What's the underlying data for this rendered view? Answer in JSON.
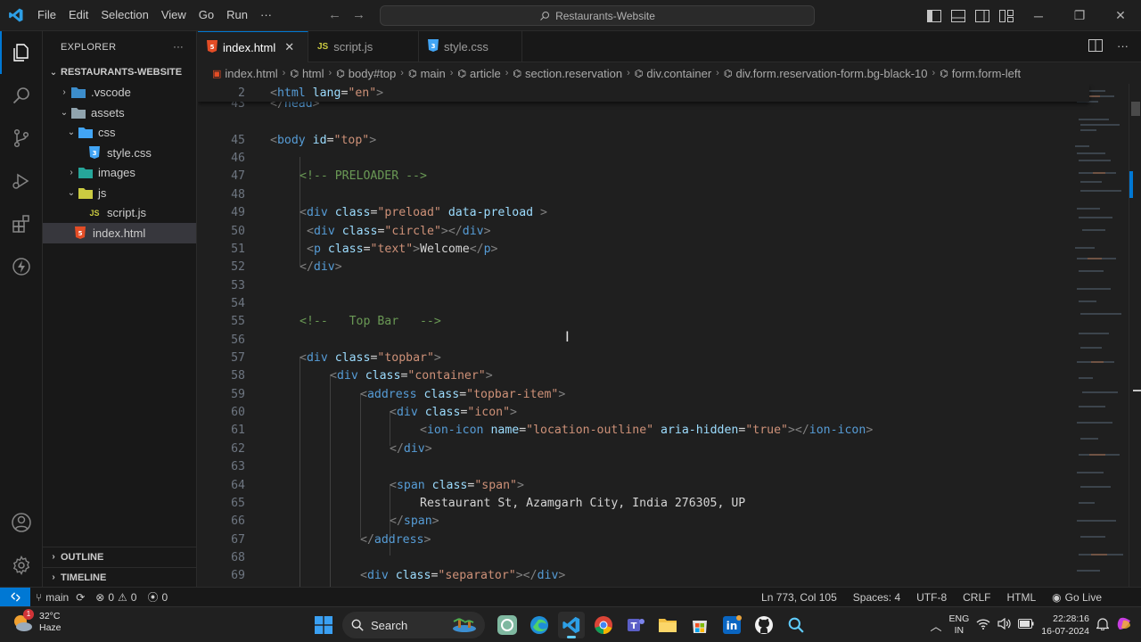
{
  "menu": [
    "File",
    "Edit",
    "Selection",
    "View",
    "Go",
    "Run"
  ],
  "menu_more": "···",
  "command_center": "Restaurants-Website",
  "explorer": {
    "title": "EXPLORER",
    "more": "···",
    "root": "RESTAURANTS-WEBSITE",
    "items": [
      ".vscode",
      "assets",
      "css",
      "style.css",
      "images",
      "js",
      "script.js",
      "index.html"
    ],
    "outline": "OUTLINE",
    "timeline": "TIMELINE"
  },
  "tabs": [
    {
      "label": "index.html",
      "icon": "html-file-icon"
    },
    {
      "label": "script.js",
      "icon": "js-file-icon"
    },
    {
      "label": "style.css",
      "icon": "css-file-icon"
    }
  ],
  "breadcrumb": [
    "index.html",
    "html",
    "body#top",
    "main",
    "article",
    "section.reservation",
    "div.container",
    "div.form.reservation-form.bg-black-10",
    "form.form-left"
  ],
  "sticky_line": {
    "number": "2"
  },
  "editor_lines": [
    {
      "n": "43"
    },
    {
      "n": "45"
    },
    {
      "n": "46"
    },
    {
      "n": "47"
    },
    {
      "n": "48"
    },
    {
      "n": "49"
    },
    {
      "n": "50"
    },
    {
      "n": "51"
    },
    {
      "n": "52"
    },
    {
      "n": "53"
    },
    {
      "n": "54"
    },
    {
      "n": "55"
    },
    {
      "n": "56"
    },
    {
      "n": "57"
    },
    {
      "n": "58"
    },
    {
      "n": "59"
    },
    {
      "n": "60"
    },
    {
      "n": "61"
    },
    {
      "n": "62"
    },
    {
      "n": "63"
    },
    {
      "n": "64"
    },
    {
      "n": "65"
    },
    {
      "n": "66"
    },
    {
      "n": "67"
    },
    {
      "n": "68"
    },
    {
      "n": "69"
    }
  ],
  "code_text": {
    "html_lang_tag": "html",
    "lang_attr": "lang",
    "lang_val": "\"en\"",
    "head_close": "head",
    "body_tag": "body",
    "id_attr": "id",
    "top_val": "\"top\"",
    "preloader_comment": "<!-- PRELOADER -->",
    "div": "div",
    "class_attr": "class",
    "preload_val": "\"preload\"",
    "data_preload": "data-preload",
    "circle_val": "\"circle\"",
    "p": "p",
    "text_val": "\"text\"",
    "welcome": "Welcome",
    "topbar_comment": "<!--   Top Bar   -->",
    "topbar_val": "\"topbar\"",
    "container_val": "\"container\"",
    "address": "address",
    "topbar_item_val": "\"topbar-item\"",
    "icon_val": "\"icon\"",
    "ion_icon": "ion-icon",
    "name_attr": "name",
    "location_val": "\"location-outline\"",
    "aria_attr": "aria-hidden",
    "true_val": "\"true\"",
    "span": "span",
    "span_val": "\"span\"",
    "address_text": "Restaurant St, Azamgarh City, India 276305, UP",
    "separator_val": "\"separator\""
  },
  "statusbar": {
    "branch": "main",
    "errors": "0",
    "warnings": "0",
    "ports": "0",
    "position": "Ln 773, Col 105",
    "spaces": "Spaces: 4",
    "encoding": "UTF-8",
    "eol": "CRLF",
    "language": "HTML",
    "golive": "Go Live"
  },
  "taskbar": {
    "weather_temp": "32°C",
    "weather_desc": "Haze",
    "weather_badge": "1",
    "search": "Search",
    "lang_line1": "ENG",
    "lang_line2": "IN",
    "time": "22:28:16",
    "date": "16-07-2024"
  },
  "colors": {
    "accent": "#0078d4",
    "html_icon": "#e44d26",
    "css_icon": "#42a5f5",
    "js_icon": "#cbcb41",
    "folder": "#90a4ae"
  }
}
